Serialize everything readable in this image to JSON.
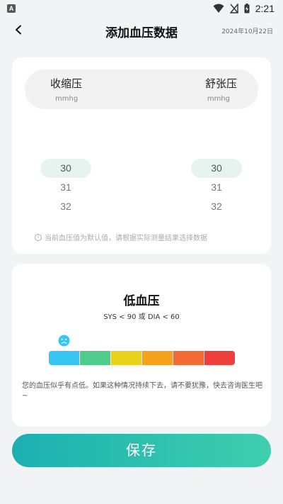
{
  "status_bar": {
    "app_badge": "A",
    "time": "2:21"
  },
  "header": {
    "title": "添加血压数据",
    "date": "2024年10月22日"
  },
  "picker": {
    "systolic_label": "收缩压",
    "systolic_unit": "mmhg",
    "diastolic_label": "舒张压",
    "diastolic_unit": "mmhg",
    "systolic_values": [
      "30",
      "31",
      "32"
    ],
    "diastolic_values": [
      "30",
      "31",
      "32"
    ],
    "note": "当前血压值为默认值，请根据实际测量结果选择数据"
  },
  "result": {
    "title": "低血压",
    "range": "SYS < 90 或 DIA < 60",
    "advice": "您的血压似乎有点低。如果这种情况持续下去，请不要犹豫，快去咨询医生吧~",
    "face_color": "#37c6f4",
    "scale_colors": [
      "#37c6f4",
      "#4fcb8c",
      "#e8d21a",
      "#f6a21d",
      "#f46c34",
      "#ef3f3a"
    ]
  },
  "save_button": {
    "label": "保存"
  }
}
